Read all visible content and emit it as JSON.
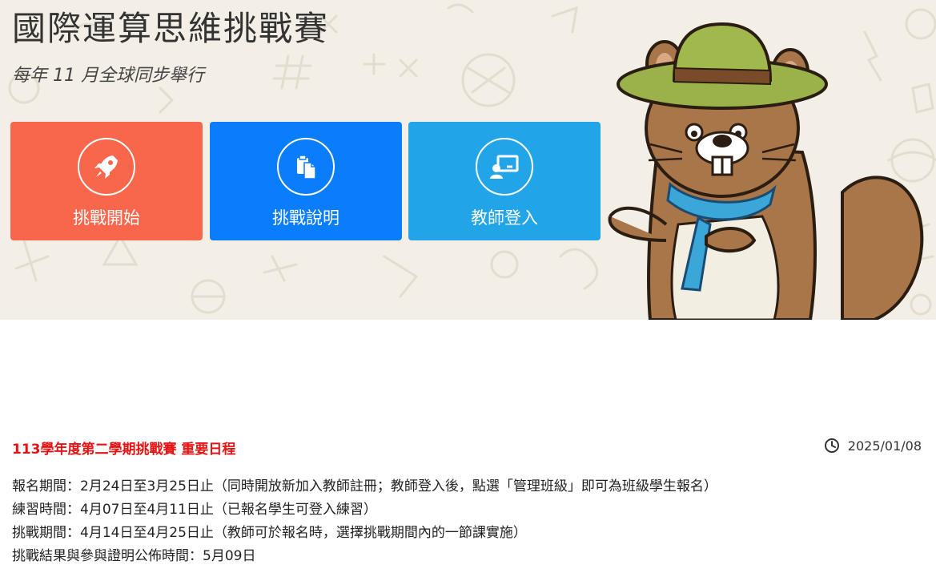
{
  "hero": {
    "title": "國際運算思維挑戰賽",
    "subtitle": "每年 11 月全球同步舉行",
    "background_color": "#f3efe7",
    "buttons": [
      {
        "label": "挑戰開始",
        "icon": "rocket-icon",
        "color": "#f8664b"
      },
      {
        "label": "挑戰說明",
        "icon": "clipboard-copy-icon",
        "color": "#0a7dfd"
      },
      {
        "label": "教師登入",
        "icon": "teacher-board-icon",
        "color": "#22a4e9"
      }
    ],
    "mascot": "beaver-with-hat-and-scarf"
  },
  "notice": {
    "title": "113學年度第二學期挑戰賽 重要日程",
    "date_icon": "clock-icon",
    "date": "2025/01/08",
    "title_color": "#e41414",
    "lines": [
      "報名期間：2月24日至3月25日止（同時開放新加入教師註冊；教師登入後，點選「管理班級」即可為班級學生報名）",
      "練習時間：4月07日至4月11日止（已報名學生可登入練習）",
      "挑戰期間：4月14日至4月25日止（教師可於報名時，選擇挑戰期間內的一節課實施）",
      "挑戰結果與參與證明公佈時間：5月09日"
    ]
  }
}
